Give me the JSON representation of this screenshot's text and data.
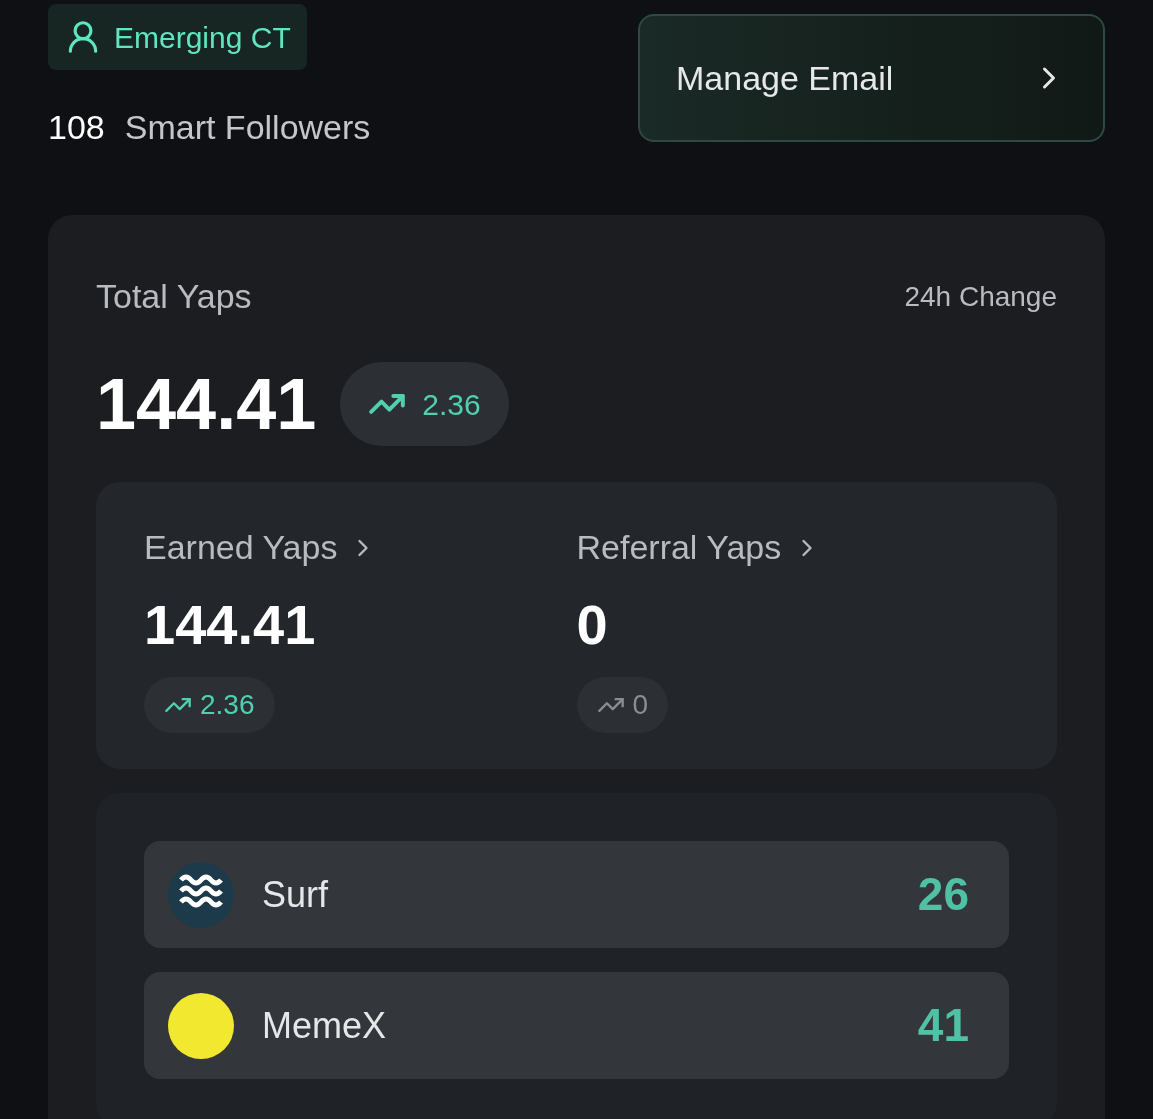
{
  "badge": {
    "label": "Emerging CT"
  },
  "followers": {
    "count": "108",
    "label": "Smart Followers"
  },
  "manage_button": {
    "label": "Manage Email"
  },
  "total": {
    "label": "Total Yaps",
    "change_label": "24h Change",
    "value": "144.41",
    "change": {
      "value": "2.36",
      "kind": "up"
    }
  },
  "breakdown": [
    {
      "label": "Earned Yaps",
      "value": "144.41",
      "change": {
        "value": "2.36",
        "kind": "up"
      }
    },
    {
      "label": "Referral Yaps",
      "value": "0",
      "change": {
        "value": "0",
        "kind": "flat"
      }
    }
  ],
  "projects": [
    {
      "name": "Surf",
      "value": "26",
      "kind": "waves"
    },
    {
      "name": "MemeX",
      "value": "41",
      "kind": "plain"
    }
  ]
}
